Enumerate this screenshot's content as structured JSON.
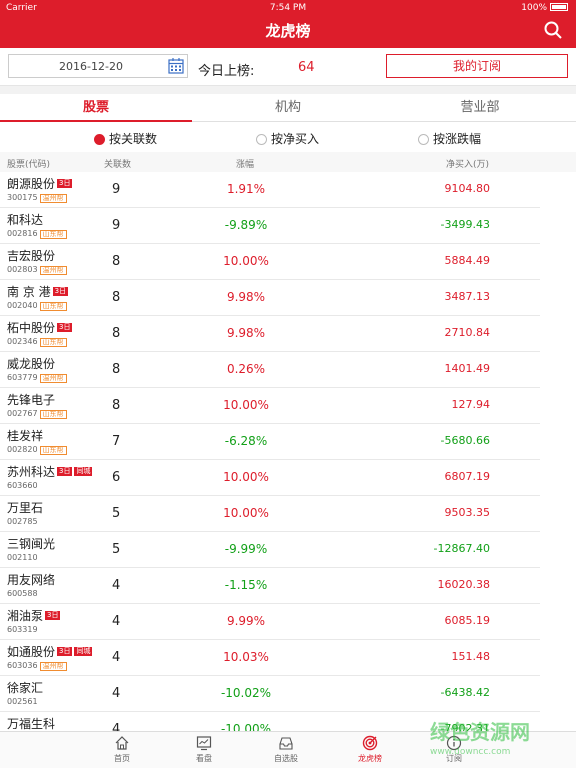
{
  "status": {
    "carrier": "Carrier",
    "time": "7:54 PM",
    "battery": "100%"
  },
  "header": {
    "title": "龙虎榜"
  },
  "info": {
    "date": "2016-12-20",
    "today_label": "今日上榜:",
    "today_count": "64",
    "subscribe_label": "我的订阅"
  },
  "tabs": [
    {
      "label": "股票"
    },
    {
      "label": "机构"
    },
    {
      "label": "营业部"
    }
  ],
  "sort": [
    {
      "label": "按关联数"
    },
    {
      "label": "按净买入"
    },
    {
      "label": "按涨跌幅"
    }
  ],
  "columns": {
    "stock": "股票(代码)",
    "count": "关联数",
    "pct": "涨幅",
    "net": "净买入(万)"
  },
  "rows": [
    {
      "name": "朗源股份",
      "code": "300175",
      "tag1": "3日",
      "tag2": "温州帮",
      "count": "9",
      "pct": "1.91%",
      "net": "9104.80",
      "pct_dir": "up",
      "net_dir": "up"
    },
    {
      "name": "和科达",
      "code": "002816",
      "tag1": "",
      "tag2": "山东帮",
      "count": "9",
      "pct": "-9.89%",
      "net": "-3499.43",
      "pct_dir": "dn",
      "net_dir": "dn"
    },
    {
      "name": "吉宏股份",
      "code": "002803",
      "tag1": "",
      "tag2": "温州帮",
      "count": "8",
      "pct": "10.00%",
      "net": "5884.49",
      "pct_dir": "up",
      "net_dir": "up"
    },
    {
      "name": "南 京 港",
      "code": "002040",
      "tag1": "3日",
      "tag2": "山东帮",
      "count": "8",
      "pct": "9.98%",
      "net": "3487.13",
      "pct_dir": "up",
      "net_dir": "up"
    },
    {
      "name": "柘中股份",
      "code": "002346",
      "tag1": "3日",
      "tag2": "山东帮",
      "count": "8",
      "pct": "9.98%",
      "net": "2710.84",
      "pct_dir": "up",
      "net_dir": "up"
    },
    {
      "name": "威龙股份",
      "code": "603779",
      "tag1": "",
      "tag2": "温州帮",
      "count": "8",
      "pct": "0.26%",
      "net": "1401.49",
      "pct_dir": "up",
      "net_dir": "up"
    },
    {
      "name": "先锋电子",
      "code": "002767",
      "tag1": "",
      "tag2": "山东帮",
      "count": "8",
      "pct": "10.00%",
      "net": "127.94",
      "pct_dir": "up",
      "net_dir": "up"
    },
    {
      "name": "桂发祥",
      "code": "002820",
      "tag1": "",
      "tag2": "山东帮",
      "count": "7",
      "pct": "-6.28%",
      "net": "-5680.66",
      "pct_dir": "dn",
      "net_dir": "dn"
    },
    {
      "name": "苏州科达",
      "code": "603660",
      "tag1": "3日",
      "tag3": "同城",
      "tag2": "",
      "count": "6",
      "pct": "10.00%",
      "net": "6807.19",
      "pct_dir": "up",
      "net_dir": "up"
    },
    {
      "name": "万里石",
      "code": "002785",
      "tag1": "",
      "tag2": "",
      "count": "5",
      "pct": "10.00%",
      "net": "9503.35",
      "pct_dir": "up",
      "net_dir": "up"
    },
    {
      "name": "三钢闽光",
      "code": "002110",
      "tag1": "",
      "tag2": "",
      "count": "5",
      "pct": "-9.99%",
      "net": "-12867.40",
      "pct_dir": "dn",
      "net_dir": "dn"
    },
    {
      "name": "用友网络",
      "code": "600588",
      "tag1": "",
      "tag2": "",
      "count": "4",
      "pct": "-1.15%",
      "net": "16020.38",
      "pct_dir": "dn",
      "net_dir": "up"
    },
    {
      "name": "湘油泵",
      "code": "603319",
      "tag1": "3日",
      "tag2": "",
      "count": "4",
      "pct": "9.99%",
      "net": "6085.19",
      "pct_dir": "up",
      "net_dir": "up"
    },
    {
      "name": "如通股份",
      "code": "603036",
      "tag1": "3日",
      "tag3": "同城",
      "tag2": "温州帮",
      "count": "4",
      "pct": "10.03%",
      "net": "151.48",
      "pct_dir": "up",
      "net_dir": "up"
    },
    {
      "name": "徐家汇",
      "code": "002561",
      "tag1": "",
      "tag2": "",
      "count": "4",
      "pct": "-10.02%",
      "net": "-6438.42",
      "pct_dir": "dn",
      "net_dir": "dn"
    },
    {
      "name": "万福生科",
      "code": "",
      "tag1": "",
      "tag2": "",
      "count": "4",
      "pct": "-10.00%",
      "net": "-7902.31",
      "pct_dir": "dn",
      "net_dir": "dn"
    }
  ],
  "bottom_tabs": [
    {
      "label": "首页",
      "icon": "home-icon"
    },
    {
      "label": "看盘",
      "icon": "monitor-icon"
    },
    {
      "label": "自选股",
      "icon": "inbox-icon"
    },
    {
      "label": "龙虎榜",
      "icon": "target-icon"
    },
    {
      "label": "订阅",
      "icon": "info-icon"
    }
  ],
  "watermark": {
    "text": "绿色资源网",
    "url": "www.downcc.com"
  },
  "colors": {
    "brand": "#dd1d2b",
    "up": "#dd1d2b",
    "down": "#12a018"
  }
}
